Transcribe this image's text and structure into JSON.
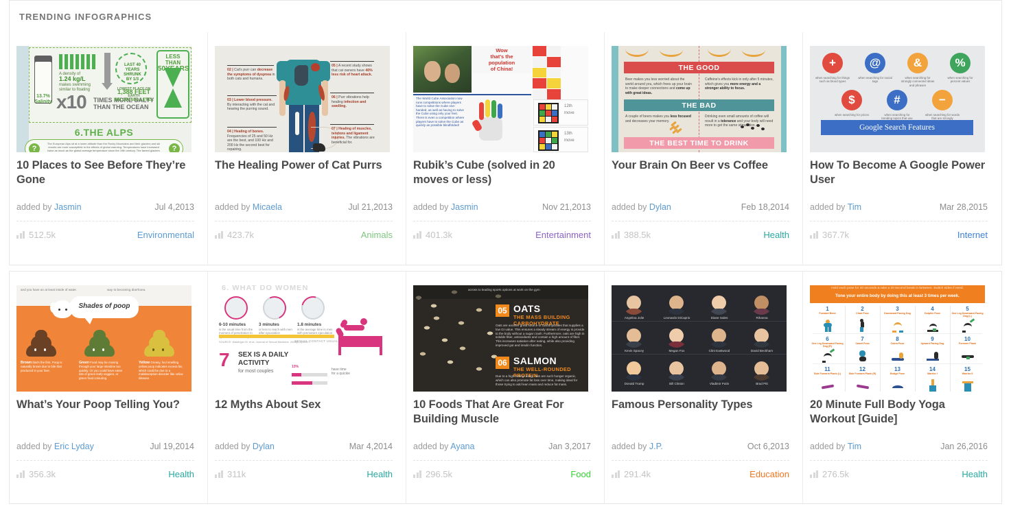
{
  "section": {
    "title": "TRENDING INFOGRAPHICS"
  },
  "labels": {
    "added_by": "added by"
  },
  "colors": {
    "title_text": "#4a4a4a",
    "author_link": "#5b9bd1",
    "views_text": "#c3c3c3",
    "category_environmental": "#5b9bd1",
    "category_animals": "#7dc67d",
    "category_entertainment": "#8b62c6",
    "category_health": "#27a8a0",
    "category_internet": "#3e7fd6",
    "category_food": "#35d435",
    "category_education": "#f0751f",
    "border": "#e7e7e7"
  },
  "cards": [
    {
      "title": "10 Places to See Before They’re Gone",
      "author": "Jasmin",
      "date": "Jul 4,2013",
      "views": "512.5k",
      "category": "Environmental",
      "category_color": "#5b9bd1",
      "thumb": "alps-salinity-infographic"
    },
    {
      "title": "The Healing Power of Cat Purrs",
      "author": "Micaela",
      "date": "Jul 21,2013",
      "views": "423.7k",
      "category": "Animals",
      "category_color": "#7dc67d",
      "thumb": "cat-purrs-body-diagram"
    },
    {
      "title": "Rubik’s Cube (solved in 20 moves or less)",
      "author": "Jasmin",
      "date": "Nov 21,2013",
      "views": "401.3k",
      "category": "Entertainment",
      "category_color": "#8b62c6",
      "thumb": "rubiks-cube-photo"
    },
    {
      "title": "Your Brain On Beer vs Coffee",
      "author": "Dylan",
      "date": "Feb 18,2014",
      "views": "388.5k",
      "category": "Health",
      "category_color": "#27a8a0",
      "thumb": "beer-vs-coffee-table"
    },
    {
      "title": "How To Become A Google Power User",
      "author": "Tim",
      "date": "Mar 28,2015",
      "views": "367.7k",
      "category": "Internet",
      "category_color": "#3e7fd6",
      "thumb": "google-search-features"
    },
    {
      "title": "What’s Your Poop Telling You?",
      "author": "Eric Lyday",
      "date": "Jul 19,2014",
      "views": "356.3k",
      "category": "Health",
      "category_color": "#27a8a0",
      "thumb": "shades-of-poop"
    },
    {
      "title": "12 Myths About Sex",
      "author": "Dylan",
      "date": "Mar 4,2014",
      "views": "311k",
      "category": "Health",
      "category_color": "#27a8a0",
      "thumb": "myths-about-sex"
    },
    {
      "title": "10 Foods That Are Great For Building Muscle",
      "author": "Ayana",
      "date": "Jan 3,2017",
      "views": "296.5k",
      "category": "Food",
      "category_color": "#35d435",
      "thumb": "oats-and-salmon"
    },
    {
      "title": "Famous Personality Types",
      "author": "J.P.",
      "date": "Oct 6,2013",
      "views": "291.4k",
      "category": "Education",
      "category_color": "#f0751f",
      "thumb": "celebrity-avatar-grid"
    },
    {
      "title": "20 Minute Full Body Yoga Workout [Guide]",
      "author": "Tim",
      "date": "Jan 26,2016",
      "views": "276.5k",
      "category": "Health",
      "category_color": "#27a8a0",
      "thumb": "yoga-pose-grid"
    }
  ],
  "thumb_text": {
    "alps": {
      "salinity": "13.7%\nSalinity",
      "density": "A density of 1.24 kg/L makes swimming similar to floating",
      "multiplier": "x 10",
      "times_more": "TIMES MORE SALTY THAN THE OCEAN",
      "depth": "377 M/1,237 FT DEEP",
      "badge": "LAST 40 YEARS SHRUNK BY 1/3",
      "below_sea": "LOWEST PLACE ON EARTH 1,388 FEET BELOW SEA LEVEL",
      "hourglass": "LESS THAN 50 YEARS",
      "section": "6.THE ALPS",
      "question_mark": "?"
    },
    "rubiks": {
      "wow": "Wow that’s the population of China!"
    },
    "beer": {
      "good": "THE GOOD",
      "bad": "THE BAD",
      "best": "THE BEST TIME TO DRINK",
      "good_beer": "Beer makes you less worried about the world around you, which frees up your brain to make deeper connections and come up with great ideas.",
      "good_coffee": "Caffeine’s effects kick in only after 5 minutes, which gives you more energy and a stronger ability to focus.",
      "bad_beer": "A couple of beers makes you less focused and decreases your memory.",
      "bad_coffee": "Drinking even small amounts of coffee will result in a tolerance and your body will need more to get the same stimulation."
    },
    "google": {
      "bar": "Google Search Features",
      "icons": [
        "+",
        "@",
        "&",
        "%",
        "$",
        "#",
        "−"
      ],
      "caption_1": "when searching for things such as blood types",
      "caption_2": "when searching for social tags",
      "caption_3": "when searching for strongly connected ideas and phrases",
      "caption_4": "when searching for percent values",
      "caption_5": "when searching for prices",
      "caption_6": "when searching for trending topics that use hashtags",
      "caption_7": "when searching for words that are strongly connected"
    },
    "poop": {
      "bubble": "Shades of poop",
      "brown_t": "Brown",
      "brown": "that’s the first. Poop is naturally brown due to bile that produced in your liver.",
      "green_t": "Green",
      "green": "Food may be moving through your large intestine too quickly. Or you could have eaten lots of green leafy veggies, or green food colouring.",
      "yellow_t": "Yellow",
      "yellow": "Greasy, foul smelling yellow poop indicates excess fat, which could be due to a malabsorption disorder like celiac disease."
    },
    "sex": {
      "header": "6. WHAT DO WOMEN",
      "b1_t": "6-10 minutes",
      "b1_s": "is the usual time from the moment of penetration to ejaculation. Three steps to",
      "b2_t": "3 minutes",
      "b2_s": "or less to reach with men after ejaculation",
      "b3_t": "1.8 minutes",
      "b3_s": "is the average time in men with premature ejaculation",
      "source": "SOURCE: Waldinger M. et al, Journal of Sexual Medicine. 2005(2;4):492-7",
      "seven": "7",
      "seven_t": "SEX IS A DAILY ACTIVITY for most couples",
      "caption": "SEXUAL CONTACT USUALLY LASTS 5 - 8 MINUTES",
      "pct": "13%"
    },
    "foods": {
      "num_oats": "05",
      "oats": "OATS",
      "oats_sub": "THE MASS BUILDING CARBOHYDRATE",
      "oats_body": "Oats are another great source of carbohydrates that supplies a low GI value. This ensures a steady stream of energy is provide to the body without a sugar crash. Furthermore, oats are high in soluble fiber, antioxidants and contain a high amount of fiber. This increases satiation after eating, while also providing improved gut and insulin function.",
      "num_salmon": "06",
      "salmon": "SALMON",
      "salmon_sub": "THE WELL-ROUNDED PROTEIN",
      "salmon_body": "Due to a high eating rating, oats are such hunger organic, which can also promote fat loss over time, making ideal for those trying to add lean mass and reduce fat mass.",
      "top": "across to leading sports options at work on the gym"
    },
    "personalities": {
      "names": [
        "Angelina Jolie",
        "Leonardo DiCaprio",
        "Diane Sales",
        "Rihanna",
        "Kevin Spacey",
        "Megan Fox",
        "Clint Eastwood",
        "David Beckham",
        "Donald Trump",
        "Bill Clinton",
        "Vladimir Putin",
        "Brad Pitt"
      ]
    },
    "yoga": {
      "line1": "Hold each pose for 40 seconds & take a 20 second break in between. Switch sides if need.",
      "line2": "Tone your entire body by doing this at least 3 times per week.",
      "poses": [
        {
          "n": "1",
          "l": "Forward Bend"
        },
        {
          "n": "2",
          "l": "Chair Pose"
        },
        {
          "n": "3",
          "l": "Downward Facing Dog"
        },
        {
          "n": "4",
          "l": "Dolphin Pose"
        },
        {
          "n": "5",
          "l": "One Leg Downward Facing Dog (L)"
        },
        {
          "n": "6",
          "l": "One Leg Downward Facing Dog (R)"
        },
        {
          "n": "7",
          "l": "Camel Pose"
        },
        {
          "n": "8",
          "l": "Cobra Pose"
        },
        {
          "n": "9",
          "l": "Upward Facing Dog"
        },
        {
          "n": "10",
          "l": "Forearm Plank"
        },
        {
          "n": "11",
          "l": "Side Forearm Plank (L)"
        },
        {
          "n": "12",
          "l": "Side Forearm Plank (R)"
        },
        {
          "n": "13",
          "l": "Bridge Pose"
        },
        {
          "n": "14",
          "l": "Warrior I"
        },
        {
          "n": "15",
          "l": "Warrior II"
        }
      ]
    }
  }
}
